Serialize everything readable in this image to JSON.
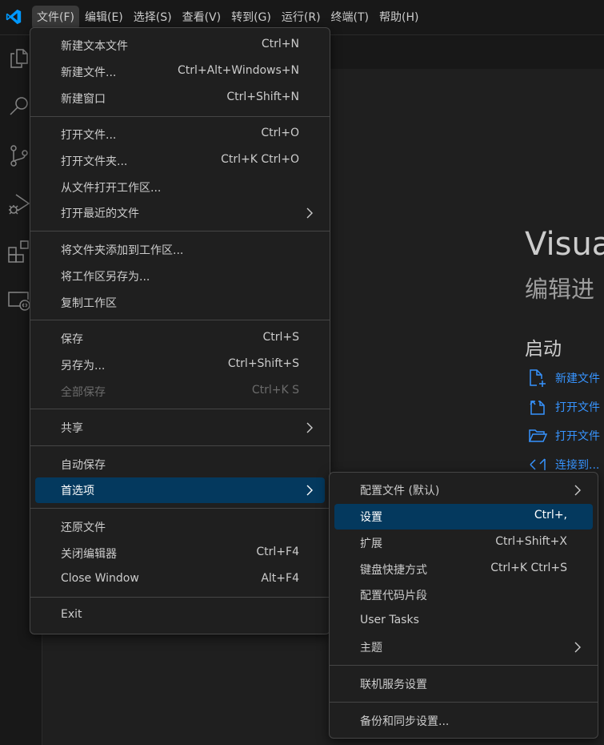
{
  "menubar": {
    "items": [
      "文件(F)",
      "编辑(E)",
      "选择(S)",
      "查看(V)",
      "转到(G)",
      "运行(R)",
      "终端(T)",
      "帮助(H)"
    ],
    "active_index": 0
  },
  "activitybar": {
    "icons": [
      "explorer-icon",
      "search-icon",
      "source-control-icon",
      "run-debug-icon",
      "extensions-icon",
      "remote-explorer-icon"
    ]
  },
  "welcome": {
    "title": "Visua",
    "subtitle": "编辑进",
    "start_heading": "启动",
    "links": [
      {
        "label": "新建文件",
        "icon": "new-file-icon"
      },
      {
        "label": "打开文件",
        "icon": "open-file-icon"
      },
      {
        "label": "打开文件",
        "icon": "open-folder-icon"
      },
      {
        "label": "连接到...",
        "icon": "remote-connect-icon"
      }
    ]
  },
  "file_menu": {
    "new_text_file": {
      "label": "新建文本文件",
      "kb": "Ctrl+N"
    },
    "new_file": {
      "label": "新建文件...",
      "kb": "Ctrl+Alt+Windows+N"
    },
    "new_window": {
      "label": "新建窗口",
      "kb": "Ctrl+Shift+N"
    },
    "open_file": {
      "label": "打开文件...",
      "kb": "Ctrl+O"
    },
    "open_folder": {
      "label": "打开文件夹...",
      "kb": "Ctrl+K Ctrl+O"
    },
    "open_workspace": {
      "label": "从文件打开工作区..."
    },
    "open_recent": {
      "label": "打开最近的文件"
    },
    "add_folder": {
      "label": "将文件夹添加到工作区..."
    },
    "save_workspace_as": {
      "label": "将工作区另存为..."
    },
    "duplicate_workspace": {
      "label": "复制工作区"
    },
    "save": {
      "label": "保存",
      "kb": "Ctrl+S"
    },
    "save_as": {
      "label": "另存为...",
      "kb": "Ctrl+Shift+S"
    },
    "save_all": {
      "label": "全部保存",
      "kb": "Ctrl+K S"
    },
    "share": {
      "label": "共享"
    },
    "auto_save": {
      "label": "自动保存"
    },
    "preferences": {
      "label": "首选项"
    },
    "revert": {
      "label": "还原文件"
    },
    "close_editor": {
      "label": "关闭编辑器",
      "kb": "Ctrl+F4"
    },
    "close_window": {
      "label": "Close Window",
      "kb": "Alt+F4"
    },
    "exit": {
      "label": "Exit"
    }
  },
  "pref_menu": {
    "profiles": {
      "label": "配置文件 (默认)"
    },
    "settings": {
      "label": "设置",
      "kb": "Ctrl+,"
    },
    "extensions": {
      "label": "扩展",
      "kb": "Ctrl+Shift+X"
    },
    "keybindings": {
      "label": "键盘快捷方式",
      "kb": "Ctrl+K Ctrl+S"
    },
    "snippets": {
      "label": "配置代码片段"
    },
    "user_tasks": {
      "label": "User Tasks"
    },
    "themes": {
      "label": "主题"
    },
    "online_services": {
      "label": "联机服务设置"
    },
    "backup_sync": {
      "label": "备份和同步设置..."
    }
  },
  "colors": {
    "accent": "#0078d4",
    "selection": "#04395e",
    "link": "#3794ff"
  }
}
